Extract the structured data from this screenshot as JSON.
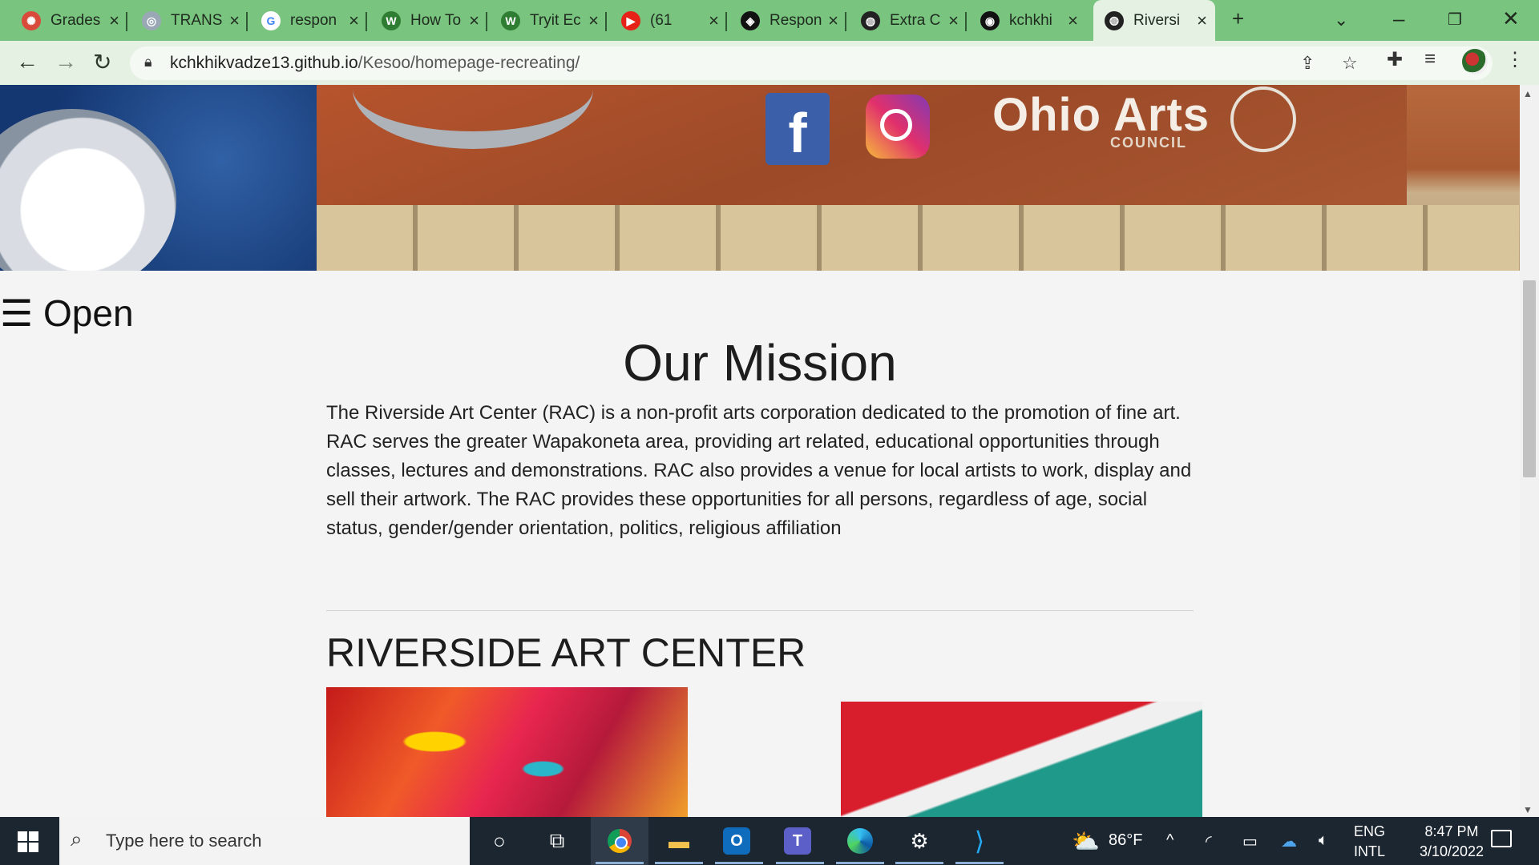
{
  "browser": {
    "tabs": [
      {
        "title": "Grades",
        "fav_color": "#d94a3a",
        "fav_glyph": "✺"
      },
      {
        "title": "TRANS",
        "fav_color": "#9aa8b5",
        "fav_glyph": "◎"
      },
      {
        "title": "respon",
        "fav_color": "#ffffff",
        "fav_glyph": "G"
      },
      {
        "title": "How To",
        "fav_color": "#2e7d32",
        "fav_glyph": "W"
      },
      {
        "title": "Tryit Ec",
        "fav_color": "#2e7d32",
        "fav_glyph": "W"
      },
      {
        "title": "(61",
        "fav_color": "#e62117",
        "fav_glyph": "▶"
      },
      {
        "title": "Respon",
        "fav_color": "#111111",
        "fav_glyph": "◈"
      },
      {
        "title": "Extra C",
        "fav_color": "#222222",
        "fav_glyph": "◍"
      },
      {
        "title": "kchkhi",
        "fav_color": "#111111",
        "fav_glyph": "◉"
      },
      {
        "title": "Riversi",
        "fav_color": "#222222",
        "fav_glyph": "◍",
        "active": true
      }
    ],
    "new_tab": "+",
    "url_host": "kchkhikvadze13.github.io",
    "url_path": "/Kesoo/homepage-recreating/"
  },
  "page": {
    "hero": {
      "fb_letter": "f",
      "logo_text": "Ohio Arts",
      "logo_sub": "COUNCIL"
    },
    "open_button": "☰ Open",
    "mission_title": "Our Mission",
    "mission_text": "The Riverside Art Center (RAC) is a non-profit arts corporation dedicated to the promotion of fine art. RAC serves the greater Wapakoneta area, providing art related, educational opportunities through classes, lectures and demonstrations. RAC also provides a venue for local artists to work, display and sell their artwork. The RAC provides these opportunities for all persons, regardless of age, social status, gender/gender orientation, politics, religious affiliation",
    "section_title": "RIVERSIDE ART CENTER"
  },
  "taskbar": {
    "search_placeholder": "Type here to search",
    "weather": "86°F",
    "lang_top": "ENG",
    "lang_bottom": "INTL",
    "time": "8:47 PM",
    "date": "3/10/2022"
  }
}
